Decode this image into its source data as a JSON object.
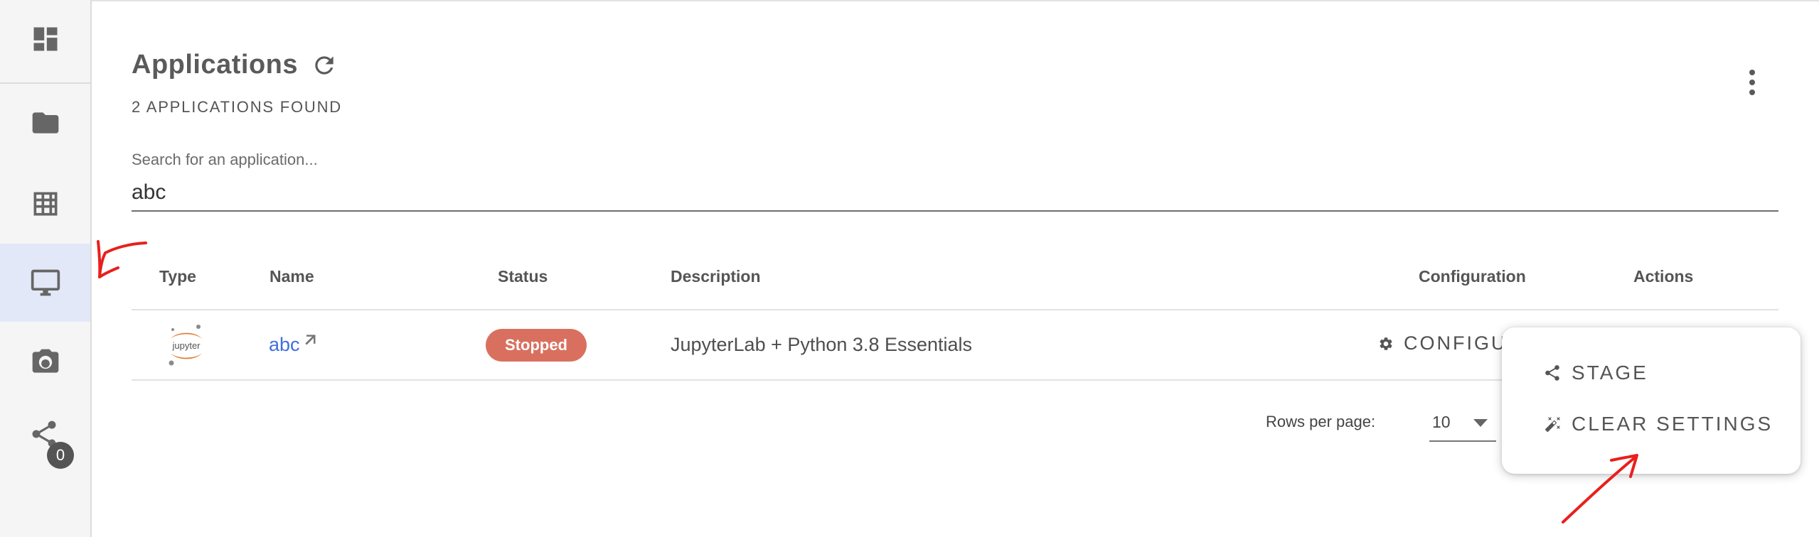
{
  "header": {
    "title": "Applications",
    "count_text": "2 APPLICATIONS FOUND"
  },
  "search": {
    "label": "Search for an application...",
    "value": "abc"
  },
  "sidebar": {
    "items": [
      {
        "icon": "dashboard-icon"
      },
      {
        "icon": "folder-icon"
      },
      {
        "icon": "table-icon"
      },
      {
        "icon": "monitor-icon",
        "active": true
      },
      {
        "icon": "camera-icon"
      },
      {
        "icon": "share-icon",
        "badge": "0"
      }
    ]
  },
  "table": {
    "columns": [
      "Type",
      "Name",
      "Status",
      "Description",
      "Configuration",
      "Actions"
    ],
    "rows": [
      {
        "type_icon": "jupyter-icon",
        "type_logo_text": "jupyter",
        "name": "abc",
        "status": "Stopped",
        "description": "JupyterLab + Python 3.8 Essentials",
        "configuration": "CONFIGU"
      }
    ]
  },
  "pagination": {
    "rows_per_page_label": "Rows per page:",
    "rows_per_page_value": "10"
  },
  "actions_menu": {
    "items": [
      {
        "label": "STAGE",
        "icon": "share-icon"
      },
      {
        "label": "CLEAR SETTINGS",
        "icon": "magic-wand-icon"
      }
    ]
  },
  "colors": {
    "accent_link": "#3f6fdc",
    "status_stopped": "#d9705f",
    "sidebar_active": "#e3e8f8",
    "annotation": "#e8201c"
  }
}
